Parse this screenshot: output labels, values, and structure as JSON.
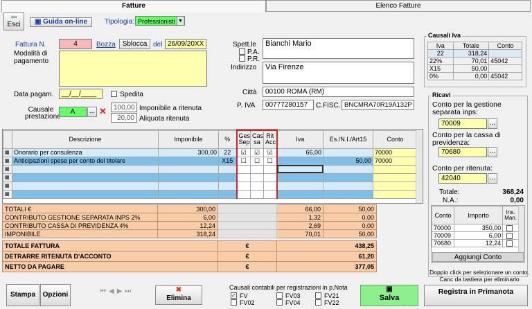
{
  "tabs": {
    "fatture": "Fatture",
    "elenco": "Elenco Fatture"
  },
  "toolbar": {
    "esci": "Esci",
    "guida": "Guida on-line",
    "tipologia_label": "Tipologia:",
    "tipologia_value": "Professionisti"
  },
  "invoice": {
    "fattura_label": "Fattura N.",
    "numero": "4",
    "bozza": "Bozza",
    "sblocca": "Sblocca",
    "del_label": "del",
    "data": "26/09/20XX",
    "modalita_label": "Modalità di pagamento",
    "modalita": "",
    "data_pagam_label": "Data pagam.",
    "data_pagam": "__/__/____",
    "spedita_label": "Spedita",
    "causale_label": "Causale prestazione",
    "causale": "A",
    "dots": "...",
    "x": "✕",
    "imponibile_ritenuta": "100,00",
    "imponibile_ritenuta_label": "Imponibile a ritenuta",
    "aliquota_ritenuta": "20,00",
    "aliquota_ritenuta_label": "Aliquota ritenuta"
  },
  "customer": {
    "spett_label": "Spett.le",
    "name": "Bianchi Mario",
    "pa_label": "P.A.",
    "pr_label": "P.R.",
    "indirizzo_label": "Indirizzo",
    "indirizzo": "Via Firenze",
    "citta_label": "Città",
    "citta": "00100  ROMA (RM)",
    "piva_label": "P. IVA",
    "piva": "00777280157",
    "cfisc_label": "C.FISC.",
    "cfisc": "BNCMRA70R19A132P"
  },
  "causali_iva": {
    "title": "Causali Iva",
    "headers": [
      "Iva",
      "Totale",
      "Conto"
    ],
    "rows": [
      [
        "22",
        "318,24",
        ""
      ],
      [
        "22%",
        "70,01",
        "45042"
      ],
      [
        "X15",
        "50,00",
        ""
      ],
      [
        "0%",
        "0,00",
        "45042"
      ]
    ]
  },
  "ricavi": {
    "title": "Ricavi",
    "gestione_label": "Conto per la gestione separata inps:",
    "gestione": "70009",
    "cassa_label": "Conto per la cassa di previdenza:",
    "cassa": "70680",
    "ritenuta_label": "Conto per ritenuta:",
    "ritenuta": "42040",
    "totale_label": "Totale:",
    "totale": "368,24",
    "na_label": "N.A.:",
    "na": "0,00",
    "headers": [
      "Conto",
      "Importo",
      "Ins. Man."
    ],
    "rows": [
      [
        "70000",
        "350,00"
      ],
      [
        "70009",
        "6,00"
      ],
      [
        "70680",
        "12,24"
      ]
    ],
    "aggiungi": "Aggiungi Conto",
    "hint": "Doppio click per selezionare un conto. Canc da tastiera per eliminarlo"
  },
  "lines": {
    "headers": {
      "descrizione": "Descrizione",
      "imponibile": "Imponibile",
      "perc": "%",
      "gessep": "Ges Sep",
      "cassa": "Cas sa",
      "ritacc": "Rit Acc",
      "iva": "Iva",
      "esente": "Es./N.I./Art15",
      "conto": "Conto"
    },
    "rows": [
      {
        "descrizione": "Onorario per consulenza",
        "imponibile": "300,00",
        "perc": "22",
        "iva": "66,00",
        "esente": "",
        "conto": "70000"
      },
      {
        "descrizione": "Anticipazioni spese per conto del titolare",
        "imponibile": "",
        "perc": "X15",
        "iva": "",
        "esente": "50,00",
        "conto": "70000"
      }
    ]
  },
  "totals": {
    "rows": [
      {
        "label": "TOTALI €",
        "imponibile": "300,00",
        "iva": "66,00",
        "esente": "50,00"
      },
      {
        "label": "CONTRIBUTO GESTIONE SEPARATA INPS 2%",
        "imponibile": "6,00",
        "iva": "1,32",
        "esente": "0,00"
      },
      {
        "label": "CONTRIBUTO CASSA DI PREVIDENZA 4%",
        "imponibile": "12,24",
        "iva": "2,69",
        "esente": "0,00"
      },
      {
        "label": "IMPONIBILE",
        "imponibile": "318,24",
        "iva": "70,01",
        "esente": "50,00"
      }
    ],
    "bold": [
      {
        "label": "TOTALE FATTURA",
        "cur": "€",
        "value": "438,25"
      },
      {
        "label": "DETRARRE RITENUTA D'ACCONTO",
        "cur": "€",
        "value": "61,20"
      },
      {
        "label": "NETTO DA PAGARE",
        "cur": "€",
        "value": "377,05"
      }
    ]
  },
  "footer": {
    "stampa": "Stampa",
    "opzioni": "Opzioni",
    "elimina": "Elimina",
    "causali_title": "Causali contabili per registrazioni in p.Nota",
    "fv": "FV",
    "fv02": "FV02",
    "fv03": "FV03",
    "fv04": "FV04",
    "fv21": "FV21",
    "fv22": "FV22",
    "salva": "Salva",
    "registra": "Registra in Primanota"
  },
  "colors": {
    "accent": "#1b3ea8",
    "yellow": "#ffffb0",
    "green": "#66ff66",
    "totals": "#f9cca8",
    "red_box": "#e02020"
  }
}
